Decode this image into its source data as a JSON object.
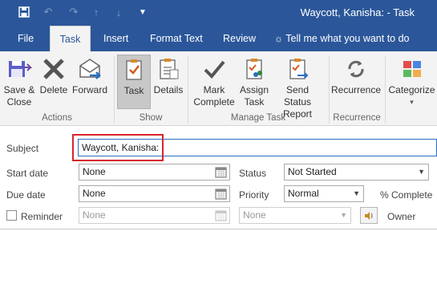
{
  "window": {
    "title": "Waycott, Kanisha:  -  Task"
  },
  "quick_access": {
    "save_icon": "save-icon",
    "undo_icon": "undo-icon",
    "redo_icon": "redo-icon",
    "up_icon": "up-arrow-icon",
    "down_icon": "down-arrow-icon",
    "more_icon": "customize-icon"
  },
  "tabs": [
    {
      "label": "File",
      "active": false
    },
    {
      "label": "Task",
      "active": true
    },
    {
      "label": "Insert",
      "active": false
    },
    {
      "label": "Format Text",
      "active": false
    },
    {
      "label": "Review",
      "active": false
    },
    {
      "label": "Tell me what you want to do",
      "active": false
    }
  ],
  "ribbon": {
    "groups": [
      {
        "label": "Actions",
        "buttons": [
          {
            "label_1": "Save &",
            "label_2": "Close",
            "icon": "save-close-icon"
          },
          {
            "label_1": "Delete",
            "label_2": "",
            "icon": "delete-icon"
          },
          {
            "label_1": "Forward",
            "label_2": "",
            "icon": "forward-icon"
          }
        ]
      },
      {
        "label": "Show",
        "buttons": [
          {
            "label_1": "Task",
            "label_2": "",
            "icon": "task-icon",
            "selected": true
          },
          {
            "label_1": "Details",
            "label_2": "",
            "icon": "details-icon"
          }
        ]
      },
      {
        "label": "Manage Task",
        "buttons": [
          {
            "label_1": "Mark",
            "label_2": "Complete",
            "icon": "checkmark-icon"
          },
          {
            "label_1": "Assign",
            "label_2": "Task",
            "icon": "assign-task-icon"
          },
          {
            "label_1": "Send Status",
            "label_2": "Report",
            "icon": "send-status-report-icon"
          }
        ]
      },
      {
        "label": "Recurrence",
        "buttons": [
          {
            "label_1": "Recurrence",
            "label_2": "",
            "icon": "recurrence-icon"
          }
        ]
      },
      {
        "label": "",
        "buttons": [
          {
            "label_1": "Categorize",
            "label_2": "",
            "icon": "categorize-icon"
          }
        ]
      }
    ]
  },
  "form": {
    "subject_label": "Subject",
    "subject_value": "Waycott, Kanisha:",
    "start_date_label": "Start date",
    "start_date_value": "None",
    "due_date_label": "Due date",
    "due_date_value": "None",
    "status_label": "Status",
    "status_value": "Not Started",
    "priority_label": "Priority",
    "priority_value": "Normal",
    "percent_complete_label": "% Complete",
    "reminder_label": "Reminder",
    "reminder_checked": false,
    "reminder_date_value": "None",
    "reminder_time_value": "None",
    "owner_label": "Owner"
  },
  "colors": {
    "title_bar": "#2b579a",
    "highlight_border": "#d7262b"
  }
}
